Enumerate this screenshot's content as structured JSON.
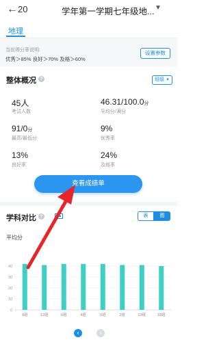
{
  "header": {
    "back_icon": "←",
    "prefix": "20",
    "title": "学年第一学期七年级地...",
    "caret": "▼"
  },
  "subject_tab": "地理",
  "score_rate": {
    "label": "当前得分率说明:",
    "levels": "优秀＞85% 良好＞70% 及格＞60%",
    "settings_button": "设置参数"
  },
  "overview": {
    "title": "整体概况",
    "help_icon": "?",
    "class_select": "班级",
    "class_select_caret": "▼",
    "stats": [
      {
        "value": "45人",
        "unit": "",
        "label": "考试人数"
      },
      {
        "value": "46.31/100.0",
        "unit": "分",
        "label": "平均分/满分"
      },
      {
        "value": "91/0",
        "unit": "分",
        "label": "最高/最低分"
      },
      {
        "value": "9%",
        "unit": "",
        "label": "优秀率"
      },
      {
        "value": "13%",
        "unit": "",
        "label": "良好率"
      },
      {
        "value": "24%",
        "unit": "",
        "label": "及格率"
      }
    ],
    "report_button": "查看成绩单"
  },
  "comparison": {
    "title": "学科对比",
    "help_icon": "?",
    "toggle_table": "表",
    "toggle_chart": "图",
    "avg_label": "平均分"
  },
  "chart_data": {
    "type": "bar",
    "ylabel": "平均分",
    "ylim": [
      0,
      50
    ],
    "yticks": [
      0,
      10,
      20,
      30,
      40
    ],
    "categories": [
      "9班",
      "12班",
      "6班",
      "4班",
      "5班",
      "2班",
      "13班",
      "18班"
    ],
    "series": [
      {
        "values": [
          42,
          41,
          42,
          42,
          42,
          41,
          41,
          40
        ]
      }
    ],
    "bar_color": "#3fcfc4",
    "grid": true
  },
  "pager": {
    "prev": "‹",
    "next": "›"
  }
}
